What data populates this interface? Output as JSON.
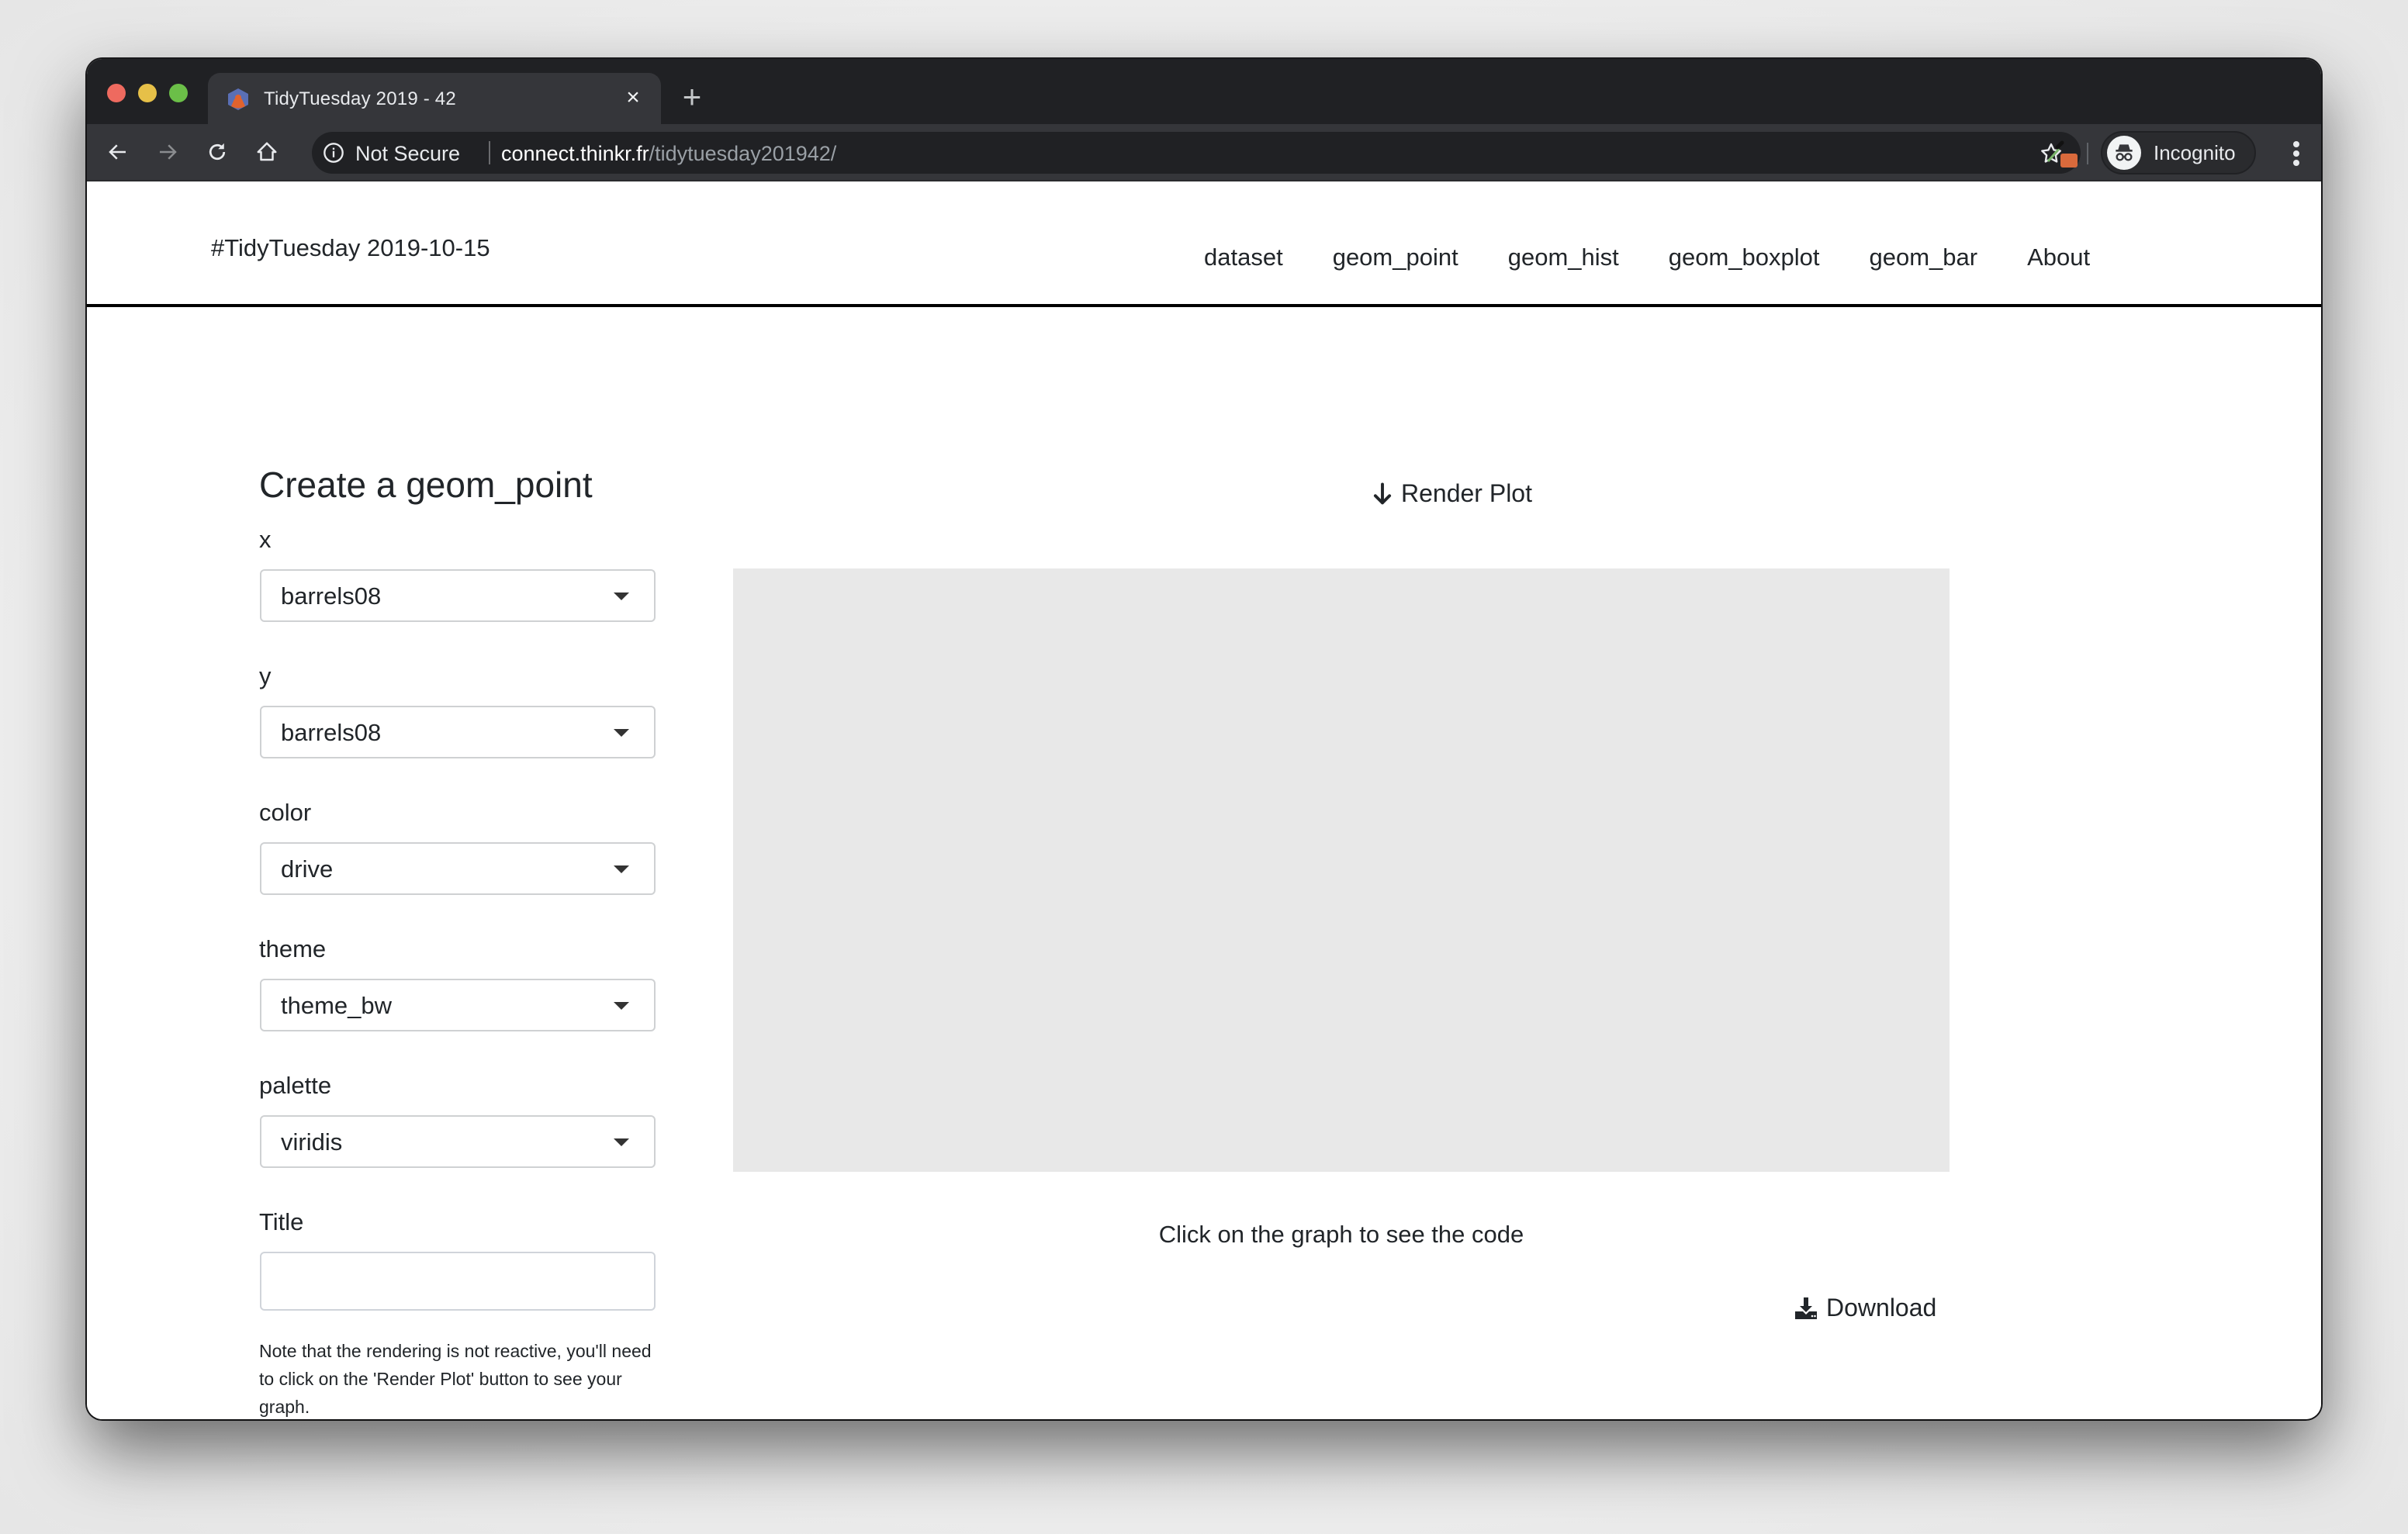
{
  "browser": {
    "tab": {
      "title": "TidyTuesday 2019 - 42",
      "close_glyph": "×",
      "favicon": "hex-sticker-icon"
    },
    "new_tab_glyph": "+",
    "address": {
      "security_label": "Not Secure",
      "url_host": "connect.thinkr.fr",
      "url_path": "/tidytuesday201942/"
    },
    "profile_label": "Incognito",
    "extension_badge_color": "#d96a3c"
  },
  "navbar": {
    "brand": "#TidyTuesday 2019-10-15",
    "links": [
      {
        "label": "dataset"
      },
      {
        "label": "geom_point"
      },
      {
        "label": "geom_hist"
      },
      {
        "label": "geom_boxplot"
      },
      {
        "label": "geom_bar"
      },
      {
        "label": "About"
      }
    ]
  },
  "sidebar": {
    "heading": "Create a geom_point",
    "fields": {
      "x": {
        "label": "x",
        "value": "barrels08"
      },
      "y": {
        "label": "y",
        "value": "barrels08"
      },
      "color": {
        "label": "color",
        "value": "drive"
      },
      "theme": {
        "label": "theme",
        "value": "theme_bw"
      },
      "palette": {
        "label": "palette",
        "value": "viridis"
      },
      "title": {
        "label": "Title",
        "value": "",
        "placeholder": ""
      }
    },
    "note": "Note that the rendering is not reactive, you'll need to click on the 'Render Plot' button to see your graph."
  },
  "main": {
    "render_button": "Render Plot",
    "plot_placeholder_color": "#e8e8e8",
    "caption": "Click on the graph to see the code",
    "download_button": "Download"
  }
}
